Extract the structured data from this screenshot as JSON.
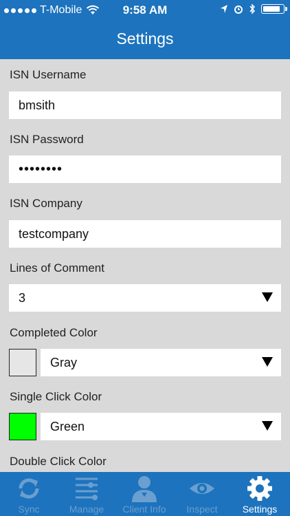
{
  "status": {
    "carrier": "T-Mobile",
    "time": "9:58 AM",
    "battery_level": 0.92
  },
  "nav": {
    "title": "Settings"
  },
  "form": {
    "username": {
      "label": "ISN Username",
      "value": "bmsith"
    },
    "password": {
      "label": "ISN Password",
      "value": "••••••••"
    },
    "company": {
      "label": "ISN Company",
      "value": "testcompany"
    },
    "lines": {
      "label": "Lines of Comment",
      "value": "3"
    },
    "completed": {
      "label": "Completed Color",
      "value": "Gray",
      "swatch": "#e6e6e6"
    },
    "single": {
      "label": "Single Click Color",
      "value": "Green",
      "swatch": "#00ff00"
    },
    "double": {
      "label": "Double Click Color"
    }
  },
  "tabs": [
    {
      "label": "Sync",
      "icon": "sync-icon"
    },
    {
      "label": "Manage",
      "icon": "sliders-icon"
    },
    {
      "label": "Client Info",
      "icon": "person-icon"
    },
    {
      "label": "Inspect",
      "icon": "eye-icon"
    },
    {
      "label": "Settings",
      "icon": "gear-icon",
      "active": true
    }
  ],
  "colors": {
    "brand": "#1d73bd",
    "background": "#d9d9d9",
    "inactive_tab": "#6a9fcf"
  }
}
